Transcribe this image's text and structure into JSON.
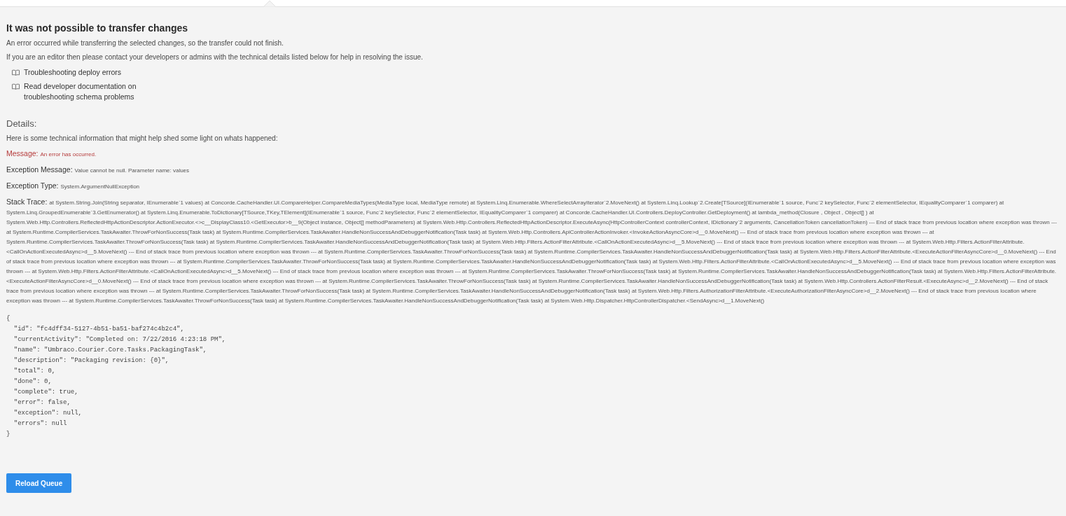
{
  "title": "It was not possible to transfer changes",
  "intro": [
    "An error occurred while transferring the selected changes, so the transfer could not finish.",
    "If you are an editor then please contact your developers or admins with the technical details listed below for help in resolving the issue."
  ],
  "links": [
    {
      "label": "Troubleshooting deploy errors"
    },
    {
      "label": "Read developer documentation on\ntroubleshooting schema problems"
    }
  ],
  "details": {
    "heading": "Details:",
    "intro": "Here is some technical information that might help shed some light on whats happened:",
    "fields": [
      {
        "kind": "error",
        "label": "Message:",
        "value": "An error has occurred."
      },
      {
        "kind": "normal",
        "label": "Exception Message:",
        "value": "Value cannot be null. Parameter name: values"
      },
      {
        "kind": "normal",
        "label": "Exception Type:",
        "value": "System.ArgumentNullException"
      },
      {
        "kind": "normal",
        "label": "Stack Trace:",
        "value": "at System.String.Join(String separator, IEnumerable`1 values) at Concorde.CacheHandler.UI.CompareHelper.CompareMediaTypes(MediaType local, MediaType remote) at System.Linq.Enumerable.WhereSelectArrayIterator`2.MoveNext() at System.Linq.Lookup`2.Create[TSource](IEnumerable`1 source, Func`2 keySelector, Func`2 elementSelector, IEqualityComparer`1 comparer) at System.Linq.GroupedEnumerable`3.GetEnumerator() at System.Linq.Enumerable.ToDictionary[TSource,TKey,TElement](IEnumerable`1 source, Func`2 keySelector, Func`2 elementSelector, IEqualityComparer`1 comparer) at Concorde.CacheHandler.UI.Controllers.DeployController.GetDeployment() at lambda_method(Closure , Object , Object[] ) at System.Web.Http.Controllers.ReflectedHttpActionDescriptor.ActionExecutor.<>c__DisplayClass10.<GetExecutor>b__9(Object instance, Object[] methodParameters) at System.Web.Http.Controllers.ReflectedHttpActionDescriptor.ExecuteAsync(HttpControllerContext controllerContext, IDictionary`2 arguments, CancellationToken cancellationToken) --- End of stack trace from previous location where exception was thrown --- at System.Runtime.CompilerServices.TaskAwaiter.ThrowForNonSuccess(Task task) at System.Runtime.CompilerServices.TaskAwaiter.HandleNonSuccessAndDebuggerNotification(Task task) at System.Web.Http.Controllers.ApiControllerActionInvoker.<InvokeActionAsyncCore>d__0.MoveNext() --- End of stack trace from previous location where exception was thrown --- at System.Runtime.CompilerServices.TaskAwaiter.ThrowForNonSuccess(Task task) at System.Runtime.CompilerServices.TaskAwaiter.HandleNonSuccessAndDebuggerNotification(Task task) at System.Web.Http.Filters.ActionFilterAttribute.<CallOnActionExecutedAsync>d__5.MoveNext() --- End of stack trace from previous location where exception was thrown --- at System.Web.Http.Filters.ActionFilterAttribute.<CallOnActionExecutedAsync>d__5.MoveNext() --- End of stack trace from previous location where exception was thrown --- at System.Runtime.CompilerServices.TaskAwaiter.ThrowForNonSuccess(Task task) at System.Runtime.CompilerServices.TaskAwaiter.HandleNonSuccessAndDebuggerNotification(Task task) at System.Web.Http.Filters.ActionFilterAttribute.<ExecuteActionFilterAsyncCore>d__0.MoveNext() --- End of stack trace from previous location where exception was thrown --- at System.Runtime.CompilerServices.TaskAwaiter.ThrowForNonSuccess(Task task) at System.Runtime.CompilerServices.TaskAwaiter.HandleNonSuccessAndDebuggerNotification(Task task) at System.Web.Http.Filters.ActionFilterAttribute.<CallOnActionExecutedAsync>d__5.MoveNext() --- End of stack trace from previous location where exception was thrown --- at System.Web.Http.Filters.ActionFilterAttribute.<CallOnActionExecutedAsync>d__5.MoveNext() --- End of stack trace from previous location where exception was thrown --- at System.Runtime.CompilerServices.TaskAwaiter.ThrowForNonSuccess(Task task) at System.Runtime.CompilerServices.TaskAwaiter.HandleNonSuccessAndDebuggerNotification(Task task) at System.Web.Http.Filters.ActionFilterAttribute.<ExecuteActionFilterAsyncCore>d__0.MoveNext() --- End of stack trace from previous location where exception was thrown --- at System.Runtime.CompilerServices.TaskAwaiter.ThrowForNonSuccess(Task task) at System.Runtime.CompilerServices.TaskAwaiter.HandleNonSuccessAndDebuggerNotification(Task task) at System.Web.Http.Controllers.ActionFilterResult.<ExecuteAsync>d__2.MoveNext() --- End of stack trace from previous location where exception was thrown --- at System.Runtime.CompilerServices.TaskAwaiter.ThrowForNonSuccess(Task task) at System.Runtime.CompilerServices.TaskAwaiter.HandleNonSuccessAndDebuggerNotification(Task task) at System.Web.Http.Filters.AuthorizationFilterAttribute.<ExecuteAuthorizationFilterAsyncCore>d__2.MoveNext() --- End of stack trace from previous location where exception was thrown --- at System.Runtime.CompilerServices.TaskAwaiter.ThrowForNonSuccess(Task task) at System.Runtime.CompilerServices.TaskAwaiter.HandleNonSuccessAndDebuggerNotification(Task task) at System.Web.Http.Dispatcher.HttpControllerDispatcher.<SendAsync>d__1.MoveNext()"
      }
    ]
  },
  "task_json": "{\n  \"id\": \"fc4dff34-5127-4b51-ba51-baf274c4b2c4\",\n  \"currentActivity\": \"Completed on: 7/22/2016 4:23:18 PM\",\n  \"name\": \"Umbraco.Courier.Core.Tasks.PackagingTask\",\n  \"description\": \"Packaging revision: {0}\",\n  \"total\": 0,\n  \"done\": 0,\n  \"complete\": true,\n  \"error\": false,\n  \"exception\": null,\n  \"errors\": null\n}",
  "button": "Reload Queue"
}
